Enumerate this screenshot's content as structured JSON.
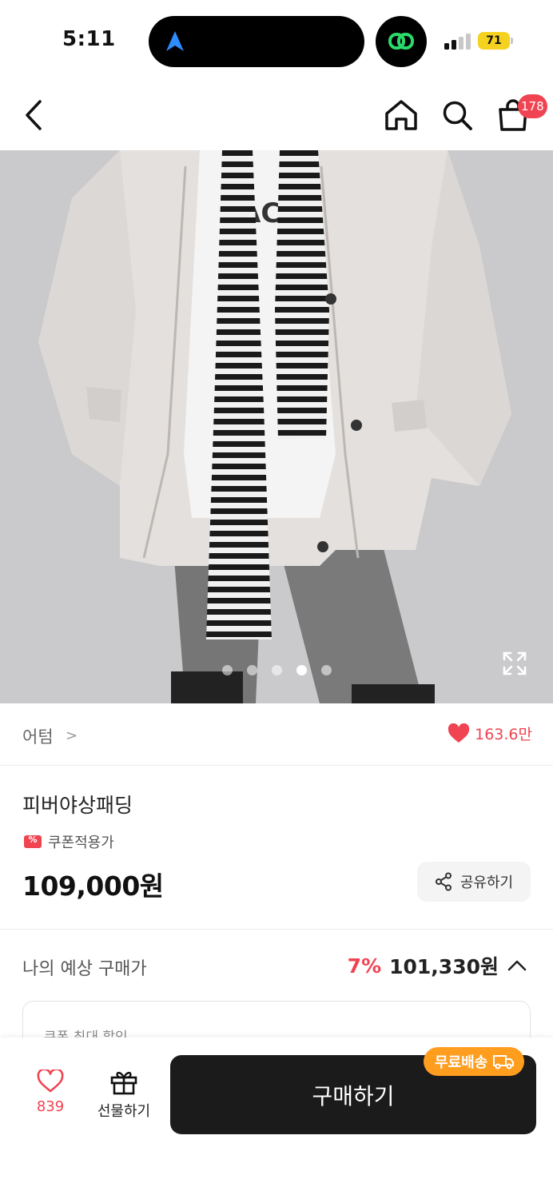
{
  "status_bar": {
    "time": "5:11",
    "battery": "71"
  },
  "header": {
    "cart_badge": "178"
  },
  "gallery": {
    "slide_count": 5,
    "active_index": 3
  },
  "brand": {
    "name": "어텀",
    "chevron": ">",
    "likes": "163.6만"
  },
  "product": {
    "title": "피버야상패딩",
    "coupon_label": "쿠폰적용가",
    "price": "109,000원",
    "share_label": "공유하기"
  },
  "expected": {
    "label": "나의 예상 구매가",
    "discount": "7%",
    "final_price": "101,330원",
    "coupon_box_label": "쿠폰 최대 할인"
  },
  "bottom_bar": {
    "wish_count": "839",
    "gift_label": "선물하기",
    "buy_label": "구매하기",
    "free_shipping": "무료배송"
  },
  "colors": {
    "accent": "#f04452",
    "buy_button": "#1b1b1b",
    "free_shipping_badge": "#ff9d1f",
    "battery": "#f5d21f"
  },
  "icons": {
    "back": "chevron-left-icon",
    "home": "home-icon",
    "search": "search-icon",
    "cart": "shopping-bag-icon",
    "expand": "expand-icon",
    "heart": "heart-icon",
    "gift": "gift-icon",
    "share": "share-icon",
    "truck": "truck-icon"
  }
}
